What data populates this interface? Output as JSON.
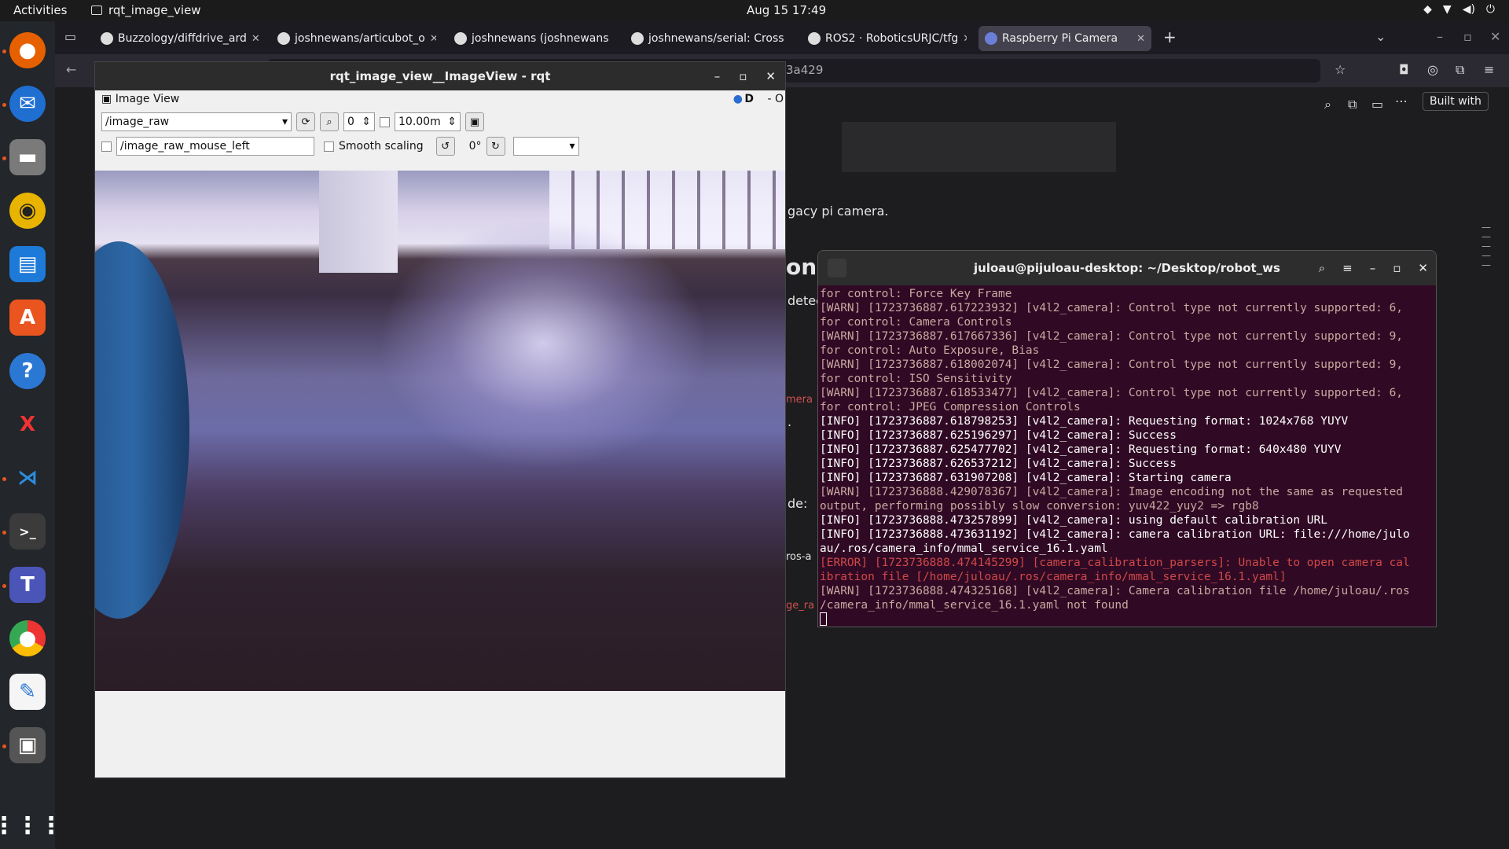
{
  "topbar": {
    "activities": "Activities",
    "app_name": "rqt_image_view",
    "clock": "Aug 15  17:49"
  },
  "browser": {
    "tabs": [
      {
        "label": "Buzzology/diffdrive_ard"
      },
      {
        "label": "joshnewans/articubot_o"
      },
      {
        "label": "joshnewans (joshnewans"
      },
      {
        "label": "joshnewans/serial: Cross"
      },
      {
        "label": "ROS2 · RoboticsURJC/tfg"
      },
      {
        "label": "Raspberry Pi Camera"
      }
    ],
    "url_fragment": "3a429",
    "built_with": "Built with",
    "page_texts": [
      "gacy pi camera.",
      "on",
      "detec",
      "mera",
      ".",
      "de:",
      "ros-a",
      "ge_ra"
    ]
  },
  "rqt": {
    "title": "rqt_image_view__ImageView - rqt",
    "panel": "Image View",
    "topic": "/image_raw",
    "spin_value": "0",
    "timeout": "10.00m",
    "mouse_topic": "/image_raw_mouse_left",
    "smooth_label": "Smooth scaling",
    "rotation": "0°",
    "dock_btns": "D",
    "dock_right": "- O"
  },
  "terminal": {
    "title": "juloau@pijuloau-desktop: ~/Desktop/robot_ws",
    "lines": [
      {
        "t": "for control: Force Key Frame",
        "c": "warn"
      },
      {
        "t": "[WARN] [1723736887.617223932] [v4l2_camera]: Control type not currently supported: 6,",
        "c": "warn"
      },
      {
        "t": "for control: Camera Controls",
        "c": "warn"
      },
      {
        "t": "[WARN] [1723736887.617667336] [v4l2_camera]: Control type not currently supported: 9,",
        "c": "warn"
      },
      {
        "t": "for control: Auto Exposure, Bias",
        "c": "warn"
      },
      {
        "t": "[WARN] [1723736887.618002074] [v4l2_camera]: Control type not currently supported: 9,",
        "c": "warn"
      },
      {
        "t": "for control: ISO Sensitivity",
        "c": "warn"
      },
      {
        "t": "[WARN] [1723736887.618533477] [v4l2_camera]: Control type not currently supported: 6,",
        "c": "warn"
      },
      {
        "t": "for control: JPEG Compression Controls",
        "c": "warn"
      },
      {
        "t": "[INFO] [1723736887.618798253] [v4l2_camera]: Requesting format: 1024x768 YUYV",
        "c": "info"
      },
      {
        "t": "[INFO] [1723736887.625196297] [v4l2_camera]: Success",
        "c": "info"
      },
      {
        "t": "[INFO] [1723736887.625477702] [v4l2_camera]: Requesting format: 640x480 YUYV",
        "c": "info"
      },
      {
        "t": "[INFO] [1723736887.626537212] [v4l2_camera]: Success",
        "c": "info"
      },
      {
        "t": "[INFO] [1723736887.631907208] [v4l2_camera]: Starting camera",
        "c": "info"
      },
      {
        "t": "[WARN] [1723736888.429078367] [v4l2_camera]: Image encoding not the same as requested",
        "c": "warn"
      },
      {
        "t": "output, performing possibly slow conversion: yuv422_yuy2 => rgb8",
        "c": "warn"
      },
      {
        "t": "[INFO] [1723736888.473257899] [v4l2_camera]: using default calibration URL",
        "c": "info"
      },
      {
        "t": "[INFO] [1723736888.473631192] [v4l2_camera]: camera calibration URL: file:///home/julo",
        "c": "info"
      },
      {
        "t": "au/.ros/camera_info/mmal_service_16.1.yaml",
        "c": "info"
      },
      {
        "t": "[ERROR] [1723736888.474145299] [camera_calibration_parsers]: Unable to open camera cal",
        "c": "err"
      },
      {
        "t": "ibration file [/home/juloau/.ros/camera_info/mmal_service_16.1.yaml]",
        "c": "err"
      },
      {
        "t": "[WARN] [1723736888.474325168] [v4l2_camera]: Camera calibration file /home/juloau/.ros",
        "c": "warn"
      },
      {
        "t": "/camera_info/mmal_service_16.1.yaml not found",
        "c": "warn"
      }
    ]
  }
}
